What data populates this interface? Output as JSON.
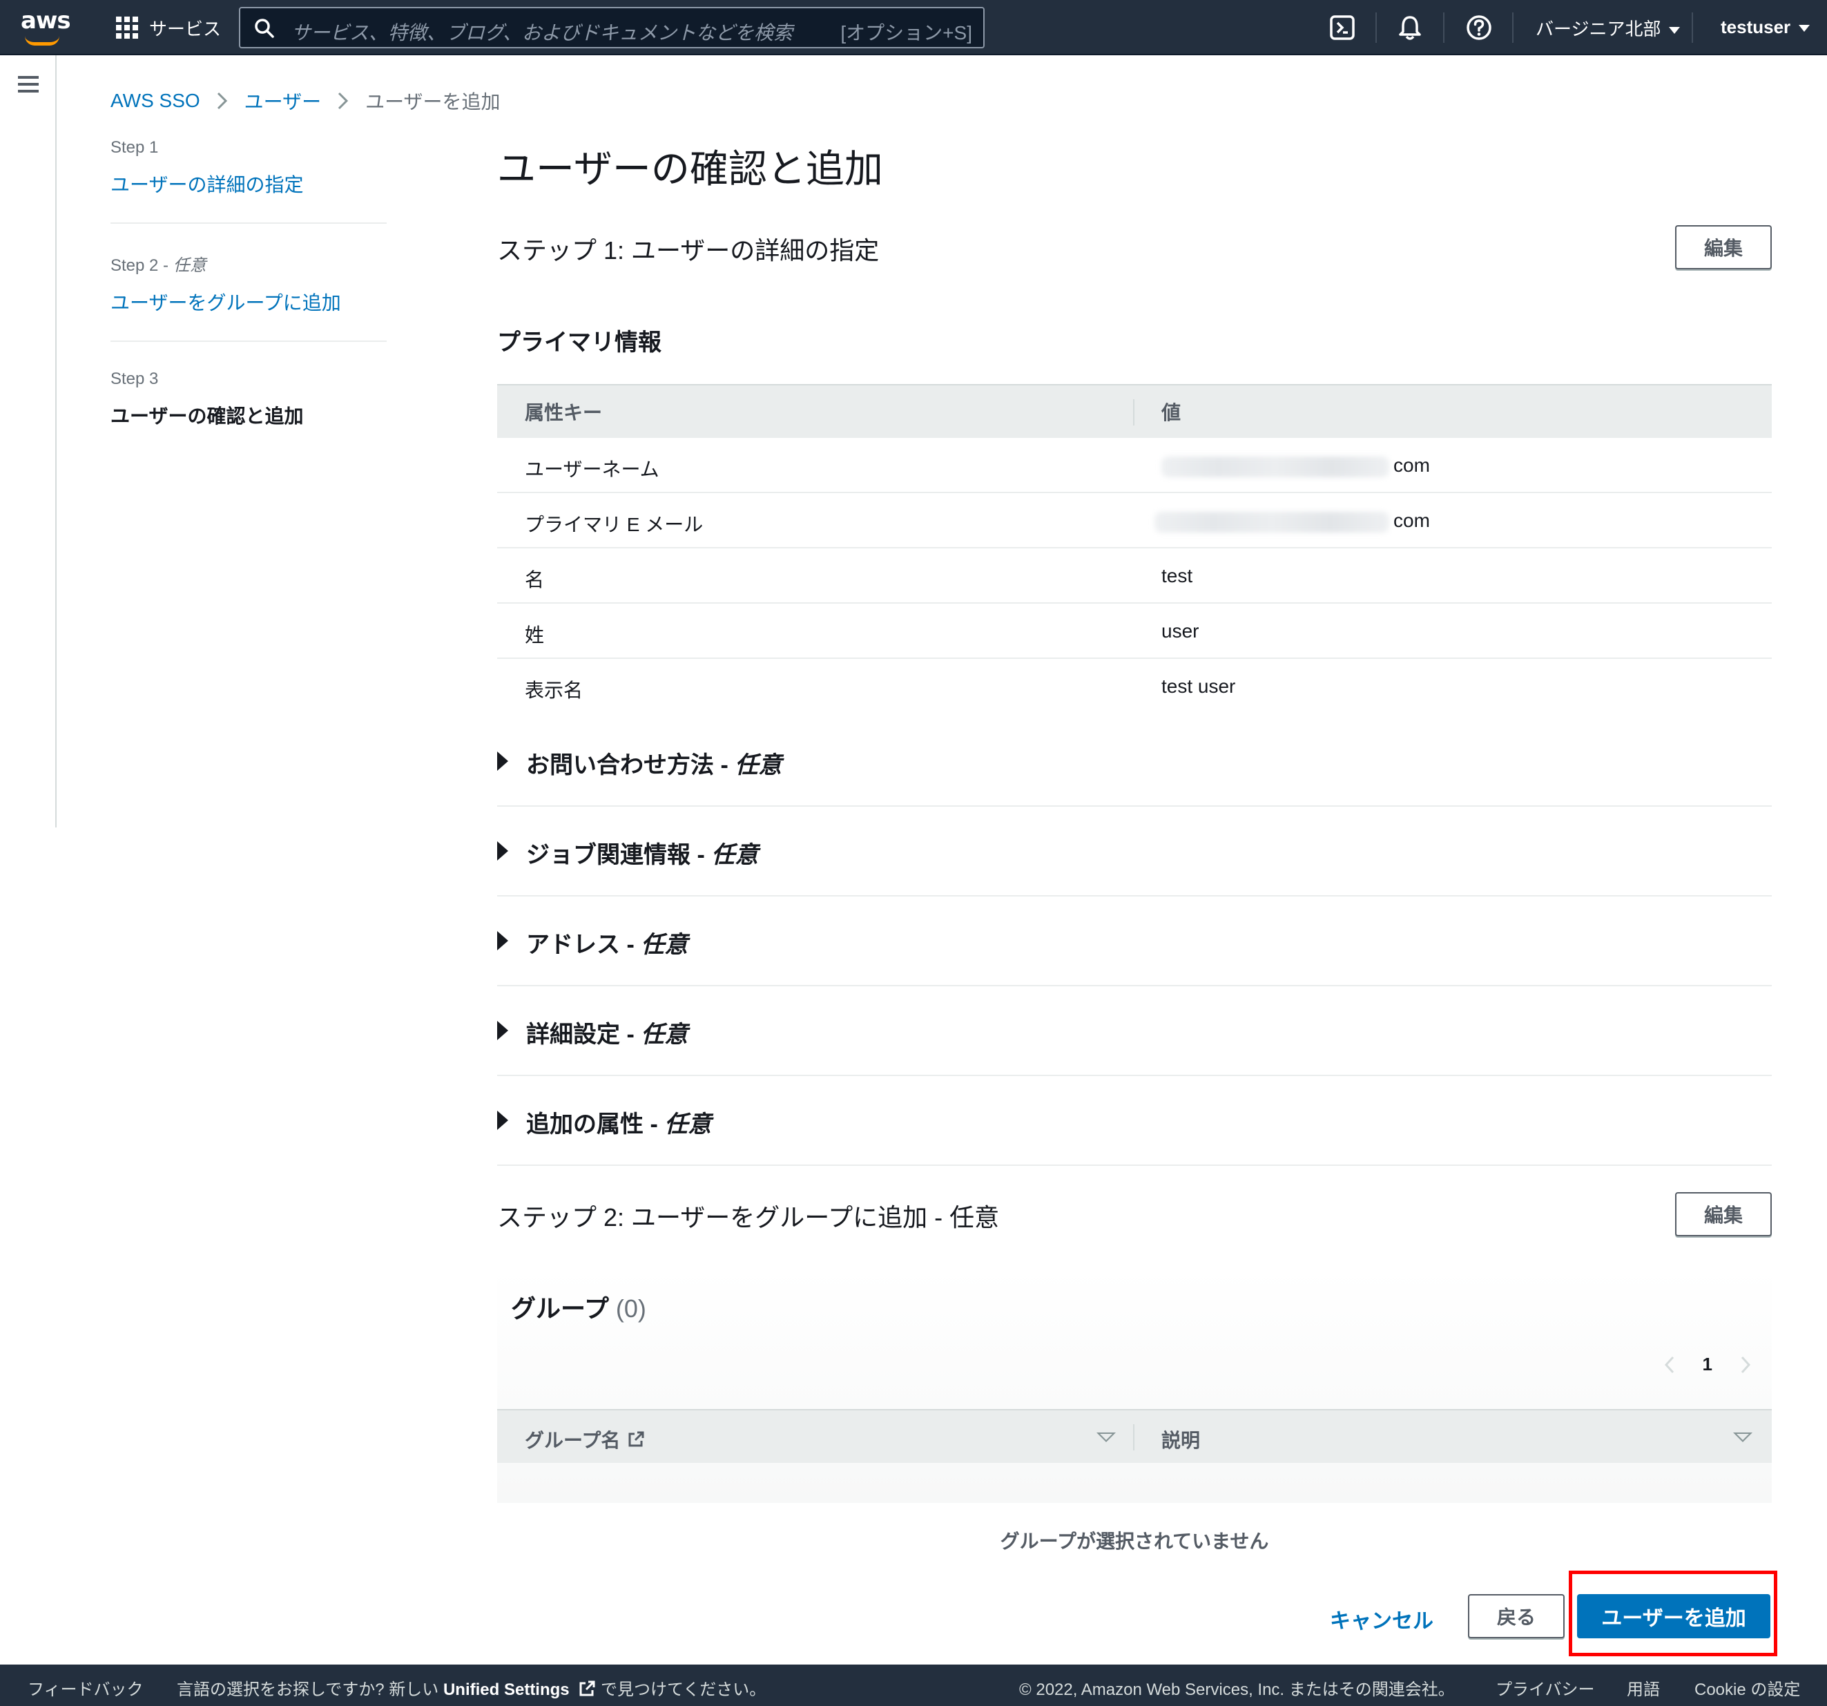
{
  "topbar": {
    "logo_text": "aws",
    "services_label": "サービス",
    "search_placeholder": "サービス、特徴、ブログ、およびドキュメントなどを検索",
    "search_shortcut": "[オプション+S]",
    "region": "バージニア北部",
    "user": "testuser"
  },
  "breadcrumb": {
    "items": [
      "AWS SSO",
      "ユーザー",
      "ユーザーを追加"
    ]
  },
  "steps": [
    {
      "label": "Step 1",
      "optional": "",
      "title": "ユーザーの詳細の指定"
    },
    {
      "label": "Step 2 - ",
      "optional": "任意",
      "title": "ユーザーをグループに追加"
    },
    {
      "label": "Step 3",
      "optional": "",
      "title": "ユーザーの確認と追加"
    }
  ],
  "main": {
    "title": "ユーザーの確認と追加",
    "step1_header": "ステップ 1: ユーザーの詳細の指定",
    "edit_label": "編集",
    "primary_info": "プライマリ情報",
    "table_headers": [
      "属性キー",
      "値"
    ],
    "rows": [
      {
        "key": "ユーザーネーム",
        "value": "com",
        "redacted": true
      },
      {
        "key": "プライマリ E メール",
        "value": "com",
        "redacted": true
      },
      {
        "key": "名",
        "value": "test",
        "redacted": false
      },
      {
        "key": "姓",
        "value": "user",
        "redacted": false
      },
      {
        "key": "表示名",
        "value": "test user",
        "redacted": false
      }
    ],
    "expanders": [
      {
        "label": "お問い合わせ方法 - ",
        "optional": "任意"
      },
      {
        "label": "ジョブ関連情報 - ",
        "optional": "任意"
      },
      {
        "label": "アドレス - ",
        "optional": "任意"
      },
      {
        "label": "詳細設定 - ",
        "optional": "任意"
      },
      {
        "label": "追加の属性 - ",
        "optional": "任意"
      }
    ],
    "step2_header": "ステップ 2: ユーザーをグループに追加 - 任意",
    "groups_title": "グループ",
    "groups_count": "(0)",
    "page_number": "1",
    "group_headers": [
      "グループ名",
      "説明"
    ],
    "empty_message": "グループが選択されていません",
    "cancel_label": "キャンセル",
    "back_label": "戻る",
    "submit_label": "ユーザーを追加"
  },
  "footer": {
    "feedback": "フィードバック",
    "lang_prefix": "言語の選択をお探しですか? 新しい ",
    "lang_link": "Unified Settings",
    "lang_suffix": " で見つけてください。",
    "copyright": "© 2022, Amazon Web Services, Inc. またはその関連会社。",
    "privacy": "プライバシー",
    "terms": "用語",
    "cookie": "Cookie の設定"
  },
  "colors": {
    "nav_bg": "#232f3e",
    "link": "#0073bb",
    "primary_button": "#0073bb",
    "highlight": "#ff0000"
  }
}
